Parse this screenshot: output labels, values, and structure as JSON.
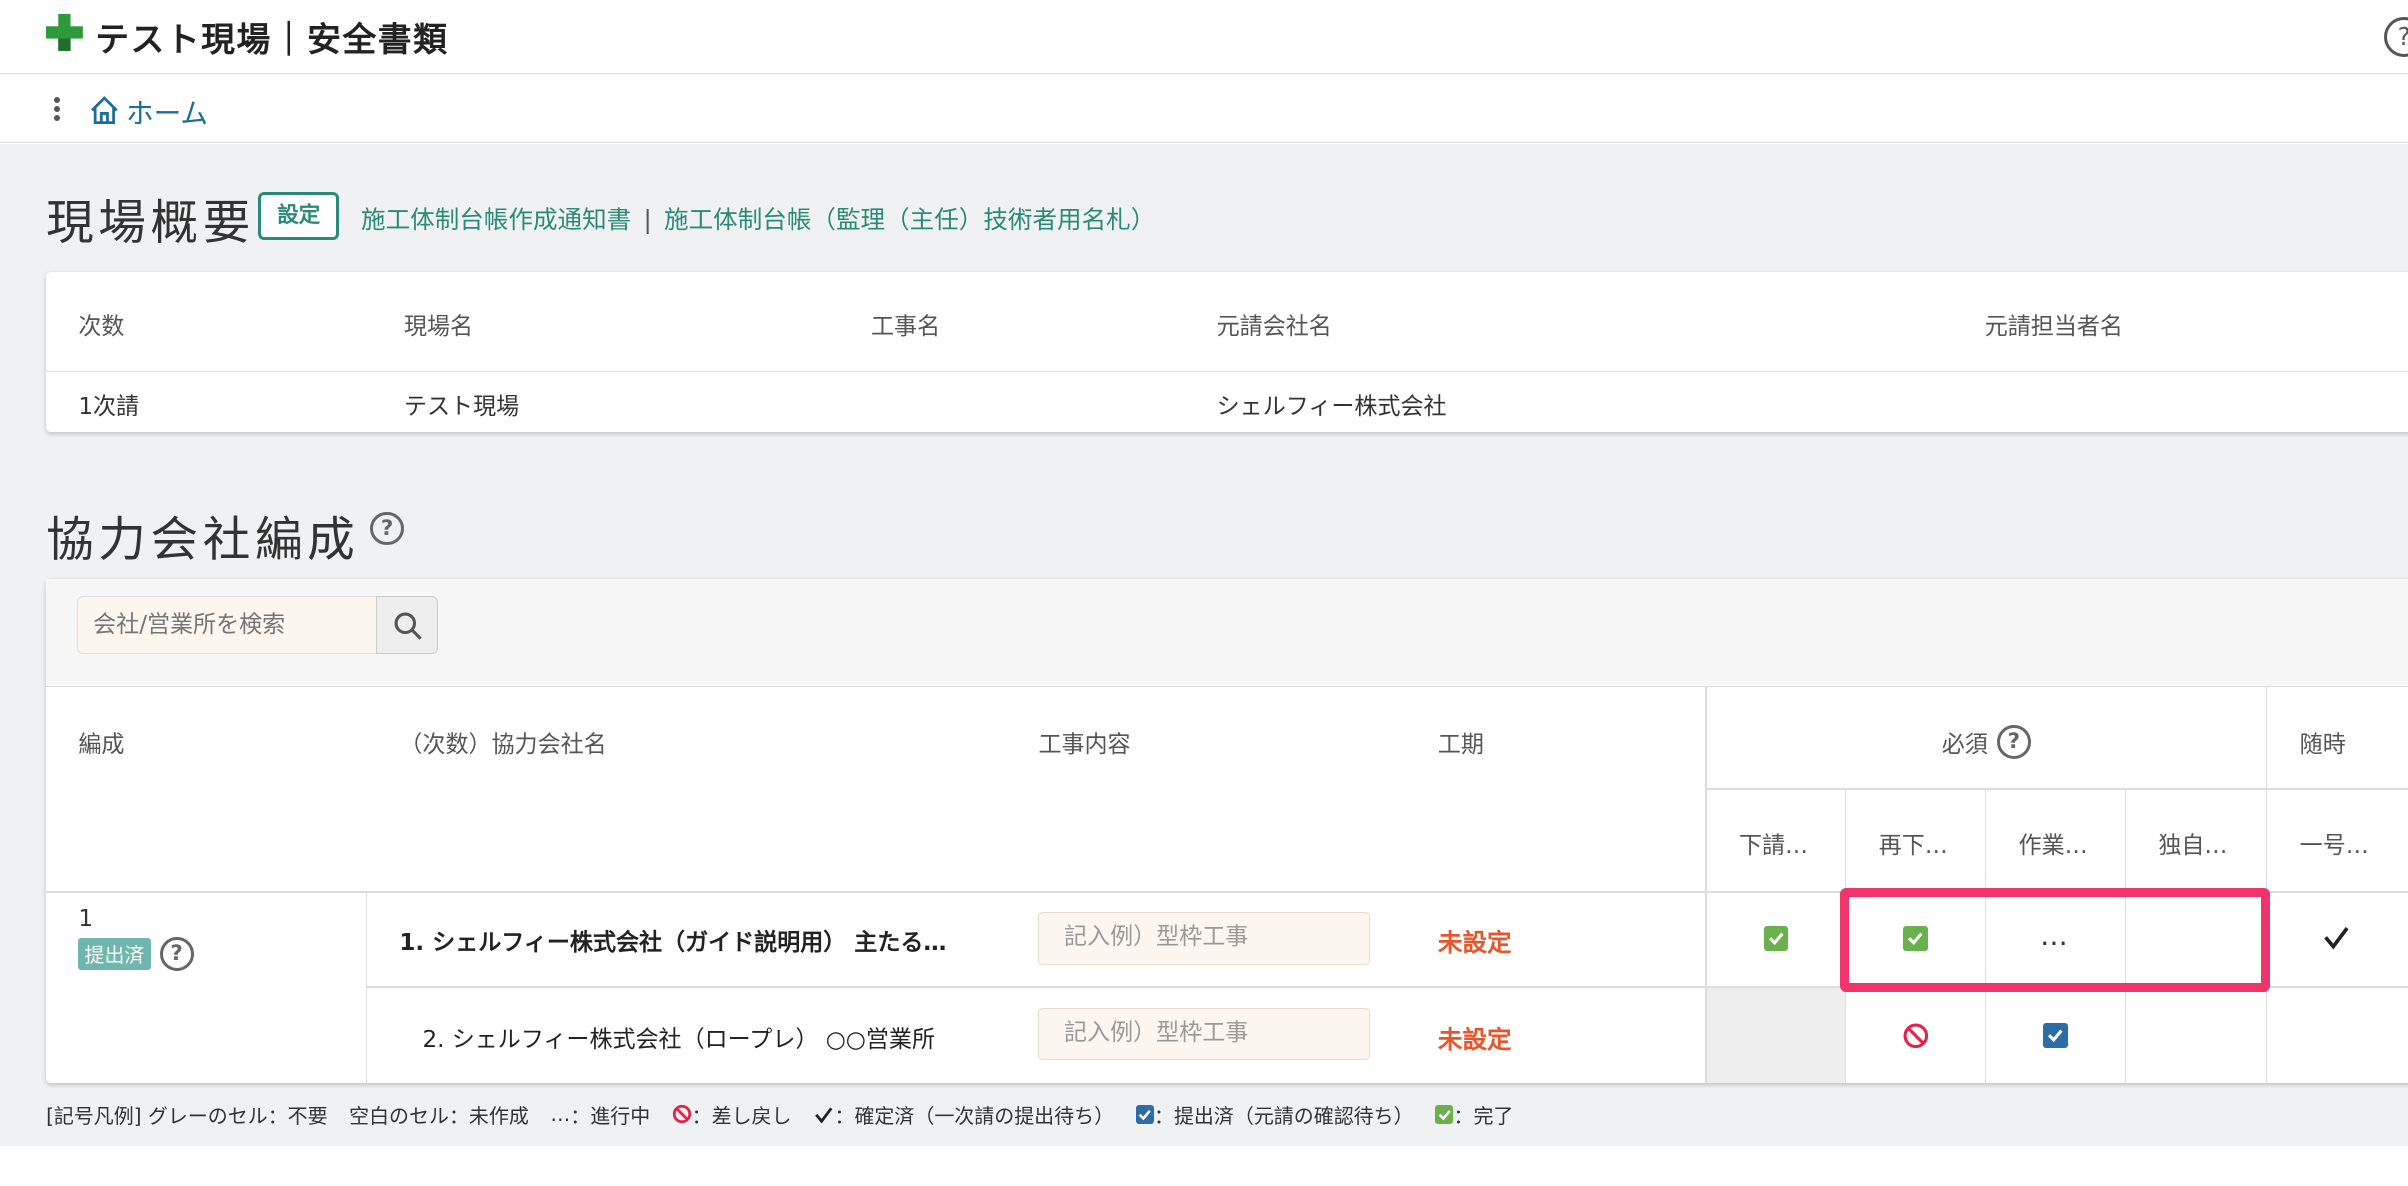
{
  "app": {
    "title": "テスト現場｜安全書類",
    "help": "?"
  },
  "nav": {
    "home_label": "ホーム"
  },
  "overview": {
    "title": "現場概要",
    "settings_label": "設定",
    "link1": "施工体制台帳作成通知書",
    "link_sep": "|",
    "link2": "施工体制台帳（監理（主任）技術者用名札）",
    "headers": [
      "次数",
      "現場名",
      "工事名",
      "元請会社名",
      "元請担当者名"
    ],
    "row": {
      "degree": "1次請",
      "site": "テスト現場",
      "work": "",
      "prime": "シェルフィー株式会社",
      "manager": ""
    }
  },
  "partners": {
    "title": "協力会社編成",
    "help": "?",
    "search_placeholder": "会社/営業所を検索",
    "headers": {
      "formation": "編成",
      "company": "（次数）協力会社名",
      "work": "工事内容",
      "period": "工期",
      "required": "必須",
      "occasional": "随時",
      "sub": [
        "下請…",
        "再下…",
        "作業…",
        "独自…",
        "一号…"
      ]
    },
    "rows": [
      {
        "formation_no": "1",
        "status": "提出済",
        "company": "1. シェルフィー株式会社（ガイド説明用） 主たる…",
        "work_placeholder": "記入例）型枠工事",
        "period": "未設定",
        "ellipsis": "…"
      },
      {
        "company": "2. シェルフィー株式会社（ロープレ） ○○営業所",
        "work_placeholder": "記入例）型枠工事",
        "period": "未設定"
      }
    ]
  },
  "legend": {
    "prefix": "[記号凡例] グレーのセル：不要",
    "blank": "空白のセル：未作成",
    "in_progress_sym": "…",
    "in_progress": "：進行中",
    "returned": "：差し戻し",
    "confirmed": "：確定済（一次請の提出待ち）",
    "submitted": "：提出済（元請の確認待ち）",
    "complete": "：完了"
  },
  "colors": {
    "accent": "#2b8a77",
    "link": "#1c6e95",
    "unset": "#e8552b",
    "highlight": "#f0336b",
    "check_green": "#6ab04c",
    "check_blue": "#2c6da6"
  }
}
